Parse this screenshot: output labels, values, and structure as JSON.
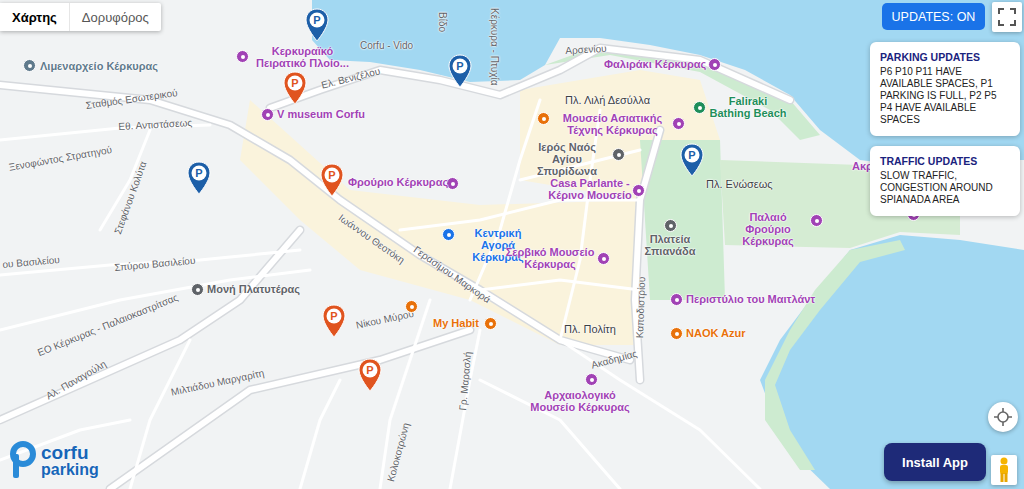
{
  "map_type_tabs": [
    {
      "label": "Χάρτης",
      "selected": true
    },
    {
      "label": "Δορυφόρος",
      "selected": false
    }
  ],
  "updates_toggle": {
    "label": "UPDATES: ON",
    "on": true
  },
  "panels": [
    {
      "title": "PARKING UPDATES",
      "text": "P6 P10 P11 HAVE AVAILABLE SPACES, P1 PARKING IS FULL, P2 P5 P4 HAVE AVAILABLE SPACES"
    },
    {
      "title": "TRAFFIC UPDATES",
      "text": "SLOW TRAFFIC, CONGESTION AROUND SPIANADA AREA"
    }
  ],
  "install_button": "Install App",
  "logo": {
    "line1": "corfu",
    "line2": "parking"
  },
  "markers": [
    {
      "glyph": "P",
      "color": "#1d5fa8"
    },
    {
      "glyph": "P",
      "color": "#1d5fa8"
    },
    {
      "glyph": "P",
      "color": "#1d5fa8"
    },
    {
      "glyph": "P",
      "color": "#1d5fa8"
    },
    {
      "glyph": "P",
      "color": "#e0541f"
    },
    {
      "glyph": "P",
      "color": "#e0541f"
    },
    {
      "glyph": "P",
      "color": "#e0541f"
    },
    {
      "glyph": "P",
      "color": "#e0541f"
    }
  ],
  "labels": [
    {
      "text": "Λιμεναρχείο Κέρκυρας",
      "kind": "poi",
      "color": "#5f7a8c"
    },
    {
      "text": "Σταθμός Εσωτερικού",
      "kind": "street"
    },
    {
      "text": "Εθ. Αντιστάσεως",
      "kind": "street"
    },
    {
      "text": "Ξενοφώντος Στρατηγού",
      "kind": "street"
    },
    {
      "text": "Κερκυραϊκό Πειρατικό Πλοίο...",
      "kind": "poi",
      "color": "#a142b5"
    },
    {
      "text": "Corfu - Vido",
      "kind": "street"
    },
    {
      "text": "Ελ. Βενιζέλου",
      "kind": "street"
    },
    {
      "text": "V museum Corfu",
      "kind": "poi",
      "color": "#a142b5"
    },
    {
      "text": "Βίδο",
      "kind": "street"
    },
    {
      "text": "Κέρκυρα - Πτυχία",
      "kind": "street"
    },
    {
      "text": "Αρσενίου",
      "kind": "street"
    },
    {
      "text": "Φαλιράκι Κέρκυρας",
      "kind": "poi",
      "color": "#a142b5"
    },
    {
      "text": "Πλ. Λιλή Δεσύλλα",
      "kind": "place"
    },
    {
      "text": "Μουσείο Ασιατικής Τέχνης Κέρκυρας",
      "kind": "poi",
      "color": "#a142b5"
    },
    {
      "text": "Faliraki Bathing Beach",
      "kind": "poi",
      "color": "#1e8e5a"
    },
    {
      "text": "Ιερός Ναός Αγίου Σπυρίδωνα",
      "kind": "poi",
      "color": "#5f6368"
    },
    {
      "text": "Πλ. Ενώσεως",
      "kind": "place"
    },
    {
      "text": "Ακρ",
      "kind": "poi",
      "color": "#a142b5"
    },
    {
      "text": "Casa Parlante - Κέρινο Μουσείο",
      "kind": "poi",
      "color": "#a142b5"
    },
    {
      "text": "Φρούριο Κέρκυρας",
      "kind": "poi",
      "color": "#a142b5"
    },
    {
      "text": "Παλαιό Φρούριο Κέρκυρας",
      "kind": "poi",
      "color": "#a142b5"
    },
    {
      "text": "Κεντρική Αγορά Κέρκυρας",
      "kind": "poi",
      "color": "#1a73e8"
    },
    {
      "text": "Πλατεία Σπιανάδα",
      "kind": "poi",
      "color": "#5f6368"
    },
    {
      "text": "Ιωάννου Θεοτόκη",
      "kind": "street"
    },
    {
      "text": "Γερασίμου Μαρκορά",
      "kind": "street"
    },
    {
      "text": "Σερβικό Μουσείο Κέρκυρας",
      "kind": "poi",
      "color": "#a142b5"
    },
    {
      "text": "Μονή Πλατυτέρας",
      "kind": "poi",
      "color": "#5f6368"
    },
    {
      "text": "Σπύρου Βασιλείου",
      "kind": "street"
    },
    {
      "text": "ου Βασιλείου",
      "kind": "street"
    },
    {
      "text": "Στεφάνου Κολύτα",
      "kind": "street"
    },
    {
      "text": "Περιστύλιο του Μαιτλάντ",
      "kind": "poi",
      "color": "#a142b5"
    },
    {
      "text": "Καποδιστρίου",
      "kind": "street"
    },
    {
      "text": "My Habit",
      "kind": "poi",
      "color": "#e8710a"
    },
    {
      "text": "Νίκου Μύρου",
      "kind": "street"
    },
    {
      "text": "Πλ. Πολίτη",
      "kind": "place"
    },
    {
      "text": "NAOK Azur",
      "kind": "poi",
      "color": "#e8710a"
    },
    {
      "text": "Ακαδημίας",
      "kind": "street"
    },
    {
      "text": "ΕΟ Κέρκυρας - Παλαιοκαστρίτσας",
      "kind": "street"
    },
    {
      "text": "Αλ. Παναγούλη",
      "kind": "street"
    },
    {
      "text": "Μιλτιάδου Μαργαρίτη",
      "kind": "street"
    },
    {
      "text": "Γρ. Μαρασλή",
      "kind": "street"
    },
    {
      "text": "Αρχαιολογικό Μουσείο Κέρκυρας",
      "kind": "poi",
      "color": "#a142b5"
    },
    {
      "text": "Κολοκοτρώνη",
      "kind": "street"
    }
  ]
}
